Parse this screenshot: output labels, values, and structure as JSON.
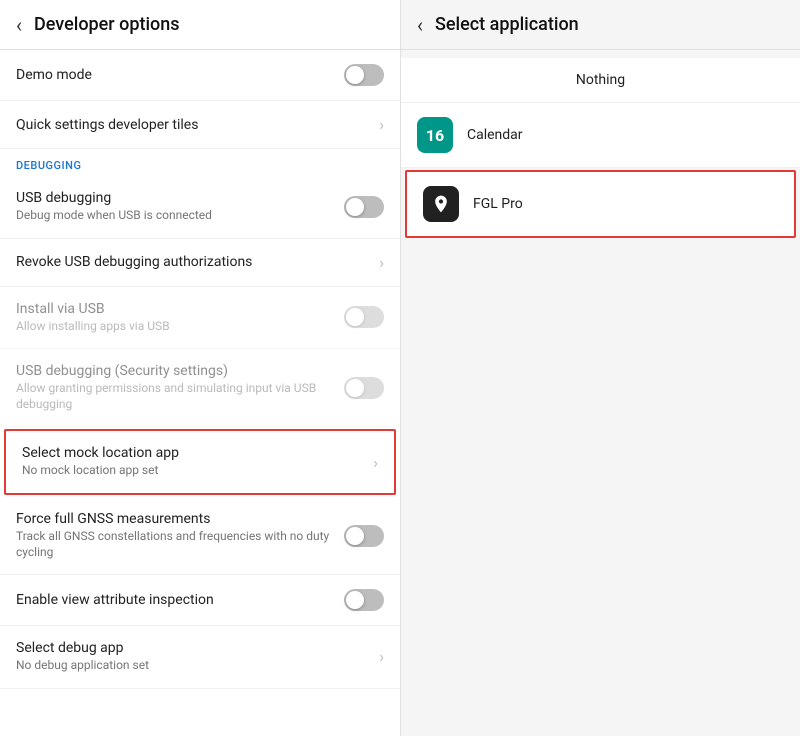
{
  "leftPanel": {
    "header": {
      "back": "‹",
      "title": "Developer options"
    },
    "items": [
      {
        "id": "demo-mode",
        "title": "Demo mode",
        "subtitle": "",
        "type": "toggle",
        "toggleOn": false,
        "disabled": false,
        "highlighted": false
      },
      {
        "id": "quick-settings",
        "title": "Quick settings developer tiles",
        "subtitle": "",
        "type": "chevron",
        "disabled": false,
        "highlighted": false
      }
    ],
    "debugSection": {
      "label": "DEBUGGING",
      "items": [
        {
          "id": "usb-debugging",
          "title": "USB debugging",
          "subtitle": "Debug mode when USB is connected",
          "type": "toggle",
          "toggleOn": false,
          "disabled": false,
          "highlighted": false
        },
        {
          "id": "revoke-usb",
          "title": "Revoke USB debugging authorizations",
          "subtitle": "",
          "type": "chevron",
          "disabled": false,
          "highlighted": false
        },
        {
          "id": "install-usb",
          "title": "Install via USB",
          "subtitle": "Allow installing apps via USB",
          "type": "toggle",
          "toggleOn": false,
          "disabled": true,
          "highlighted": false
        },
        {
          "id": "usb-security",
          "title": "USB debugging (Security settings)",
          "subtitle": "Allow granting permissions and simulating input via USB debugging",
          "type": "toggle",
          "toggleOn": false,
          "disabled": true,
          "highlighted": false
        },
        {
          "id": "select-mock",
          "title": "Select mock location app",
          "subtitle": "No mock location app set",
          "type": "chevron",
          "disabled": false,
          "highlighted": true
        },
        {
          "id": "force-gnss",
          "title": "Force full GNSS measurements",
          "subtitle": "Track all GNSS constellations and frequencies with no duty cycling",
          "type": "toggle",
          "toggleOn": false,
          "disabled": false,
          "highlighted": false
        },
        {
          "id": "view-attribute",
          "title": "Enable view attribute inspection",
          "subtitle": "",
          "type": "toggle",
          "toggleOn": false,
          "disabled": false,
          "highlighted": false
        },
        {
          "id": "select-debug",
          "title": "Select debug app",
          "subtitle": "No debug application set",
          "type": "chevron",
          "disabled": false,
          "highlighted": false
        }
      ]
    }
  },
  "rightPanel": {
    "header": {
      "back": "‹",
      "title": "Select application"
    },
    "apps": [
      {
        "id": "nothing",
        "name": "Nothing",
        "iconType": "none",
        "highlighted": false
      },
      {
        "id": "calendar",
        "name": "Calendar",
        "iconType": "calendar",
        "iconText": "16",
        "highlighted": false
      },
      {
        "id": "fgl-pro",
        "name": "FGL Pro",
        "iconType": "fgl",
        "iconText": "📍",
        "highlighted": true
      }
    ]
  }
}
